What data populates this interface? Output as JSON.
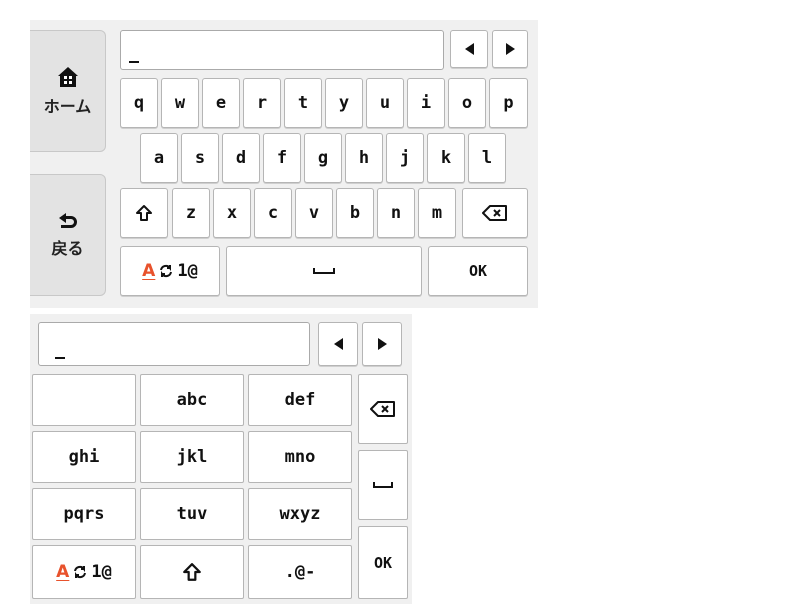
{
  "keyboard_full": {
    "home_label": "ホーム",
    "back_label": "戻る",
    "input_cursor": "_",
    "row1": [
      "q",
      "w",
      "e",
      "r",
      "t",
      "y",
      "u",
      "i",
      "o",
      "p"
    ],
    "row2": [
      "a",
      "s",
      "d",
      "f",
      "g",
      "h",
      "j",
      "k",
      "l"
    ],
    "row3": [
      "z",
      "x",
      "c",
      "v",
      "b",
      "n",
      "m"
    ],
    "mode_key_letter": "A",
    "mode_key_rest": "1@",
    "ok_label": "OK"
  },
  "keyboard_phone": {
    "input_cursor": "_",
    "keys": [
      "",
      "abc",
      "def",
      "ghi",
      "jkl",
      "mno",
      "pqrs",
      "tuv",
      "wxyz"
    ],
    "mode_key_letter": "A",
    "mode_key_rest": "1@",
    "symbols_label": ".@-",
    "ok_label": "OK"
  },
  "colors": {
    "panel_bg": "#f0f0f0",
    "accent_mode_letter": "#e8522c"
  }
}
